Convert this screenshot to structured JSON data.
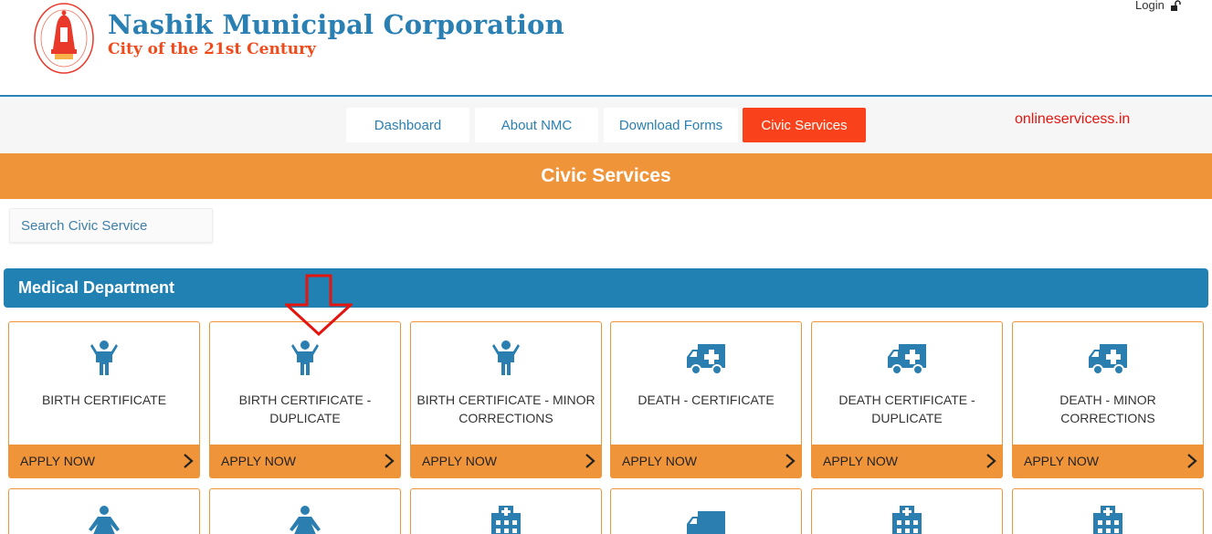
{
  "header": {
    "title": "Nashik Municipal Corporation",
    "subtitle": "City of the 21st Century",
    "login_label": "Login"
  },
  "nav": {
    "items": [
      {
        "label": "Dashboard"
      },
      {
        "label": "About NMC"
      },
      {
        "label": "Download Forms"
      },
      {
        "label": "Civic Services"
      }
    ],
    "active": "Civic Services",
    "watermark": "onlineservicess.in"
  },
  "banner": {
    "title": "Civic Services"
  },
  "search": {
    "placeholder": "Search Civic Service"
  },
  "department": {
    "title": "Medical Department",
    "cards": [
      {
        "label": "BIRTH CERTIFICATE",
        "icon": "child-icon",
        "cta": "APPLY NOW"
      },
      {
        "label": "BIRTH CERTIFICATE - DUPLICATE",
        "icon": "child-icon",
        "cta": "APPLY NOW"
      },
      {
        "label": "BIRTH CERTIFICATE - MINOR CORRECTIONS",
        "icon": "child-icon",
        "cta": "APPLY NOW"
      },
      {
        "label": "DEATH - CERTIFICATE",
        "icon": "ambulance-icon",
        "cta": "APPLY NOW"
      },
      {
        "label": "DEATH CERTIFICATE - DUPLICATE",
        "icon": "ambulance-icon",
        "cta": "APPLY NOW"
      },
      {
        "label": "DEATH - MINOR CORRECTIONS",
        "icon": "ambulance-icon",
        "cta": "APPLY NOW"
      }
    ],
    "second_row_icons": [
      "female-icon",
      "female-icon",
      "hospital-icon",
      "truck-icon",
      "hospital-icon",
      "hospital-icon"
    ]
  },
  "colors": {
    "brand_blue": "#2a7fb3",
    "accent_orange": "#f09439",
    "active_red": "#f9421b",
    "dept_blue": "#2181b3"
  }
}
